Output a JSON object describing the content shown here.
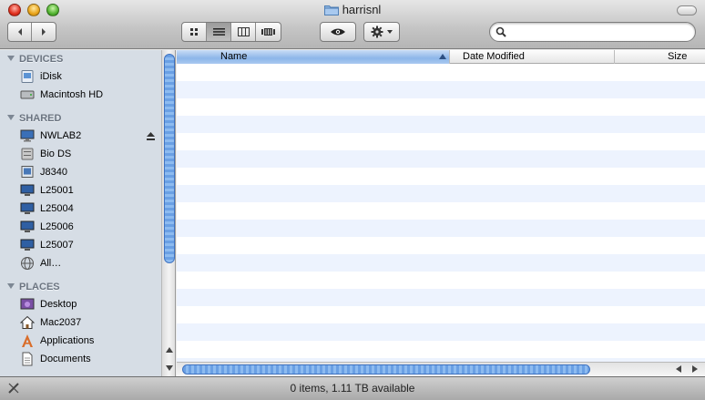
{
  "window": {
    "title": "harrisnl"
  },
  "toolbar": {
    "back_icon": "chevron-left-icon",
    "forward_icon": "chevron-right-icon",
    "view_modes": [
      "icon-view",
      "list-view",
      "column-view",
      "coverflow-view"
    ],
    "active_view": "list-view",
    "quicklook_icon": "eye-icon",
    "action_icon": "gear-icon",
    "search_placeholder": ""
  },
  "sidebar": {
    "sections": [
      {
        "label": "DEVICES",
        "items": [
          {
            "label": "iDisk",
            "icon": "idisk-icon"
          },
          {
            "label": "Macintosh HD",
            "icon": "hard-drive-icon"
          }
        ]
      },
      {
        "label": "SHARED",
        "items": [
          {
            "label": "NWLAB2",
            "icon": "network-computer-icon",
            "eject": true
          },
          {
            "label": "Bio DS",
            "icon": "server-icon"
          },
          {
            "label": "J8340",
            "icon": "network-computer-icon"
          },
          {
            "label": "L25001",
            "icon": "display-icon"
          },
          {
            "label": "L25004",
            "icon": "display-icon"
          },
          {
            "label": "L25006",
            "icon": "display-icon"
          },
          {
            "label": "L25007",
            "icon": "display-icon"
          },
          {
            "label": "All…",
            "icon": "network-globe-icon"
          }
        ]
      },
      {
        "label": "PLACES",
        "items": [
          {
            "label": "Desktop",
            "icon": "desktop-icon"
          },
          {
            "label": "Mac2037",
            "icon": "home-icon"
          },
          {
            "label": "Applications",
            "icon": "applications-icon"
          },
          {
            "label": "Documents",
            "icon": "documents-icon"
          }
        ]
      }
    ]
  },
  "columns": {
    "name": "Name",
    "date": "Date Modified",
    "size": "Size"
  },
  "status": {
    "text": "0 items, 1.11 TB available"
  },
  "colors": {
    "selection_blue": "#8cb6e9",
    "stripe": "#edf3fe",
    "sidebar_bg": "#d6dde5"
  }
}
